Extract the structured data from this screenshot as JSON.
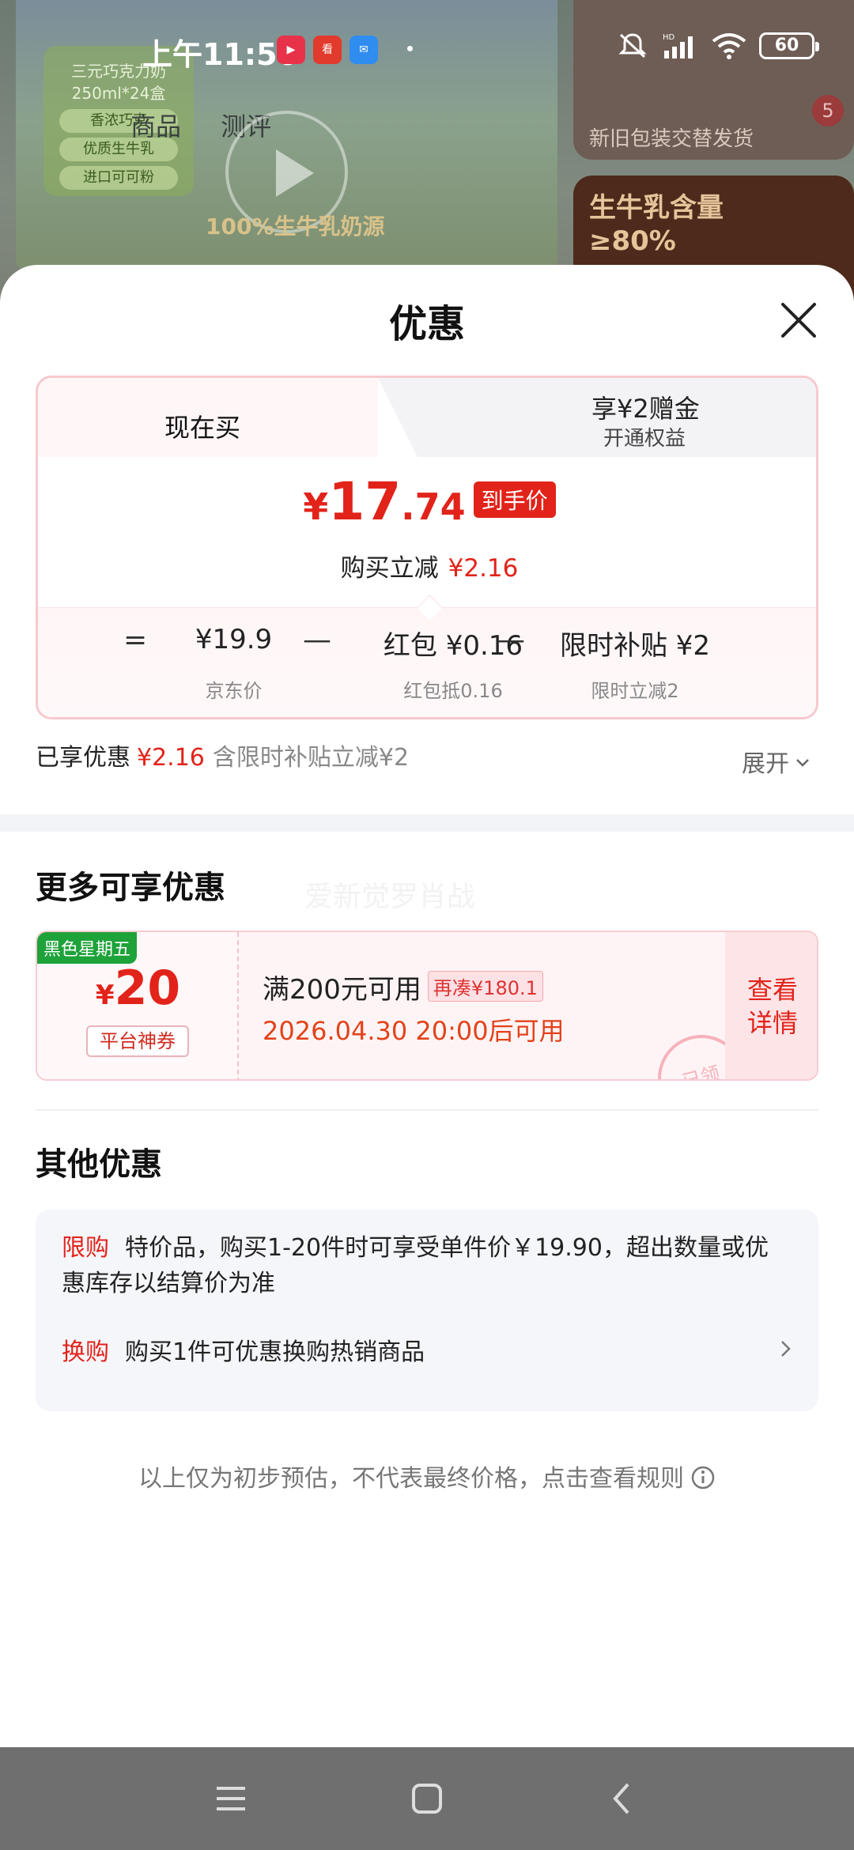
{
  "status_bar": {
    "time": "上午11:50",
    "battery": "60",
    "network_label": "HD",
    "app_icons": [
      "video-app-icon",
      "news-app-icon",
      "chat-app-icon"
    ]
  },
  "background": {
    "tabs": [
      "商品",
      "测评"
    ],
    "green_box_lines": [
      "三元巧克力奶",
      "250ml*24盒"
    ],
    "green_box_tags": [
      "香浓巧克",
      "优质生牛乳",
      "进口可可粉"
    ],
    "slogan": "100%生牛乳奶源",
    "card1_caption": "新旧包装交替发货",
    "card2_caption": "生牛乳含量\n≥80%",
    "badge": "5"
  },
  "sheet": {
    "title": "优惠",
    "tabs": {
      "now": "现在买",
      "other_title": "享¥2赠金",
      "other_sub": "开通权益"
    },
    "price": {
      "yen": "¥",
      "integer": "17",
      "decimal": ".74",
      "tag": "到手价",
      "reduce_label": "购买立减",
      "reduce_amount": "¥2.16"
    },
    "breakdown": {
      "eq": "=",
      "items": [
        {
          "value": "¥19.9",
          "sub": "京东价"
        },
        {
          "value": "红包 ¥0.16",
          "sub": "红包抵0.16"
        },
        {
          "value": "限时补贴 ¥2",
          "sub": "限时立减2"
        }
      ],
      "op": "—"
    },
    "enjoyed": {
      "label": "已享优惠",
      "amount": "¥2.16",
      "note": "含限时补贴立减¥2",
      "expand": "展开"
    },
    "more": {
      "title": "更多可享优惠",
      "watermark": "爱新觉罗肖战",
      "coupon": {
        "tag": "黑色星期五",
        "yen": "¥",
        "amount": "20",
        "type": "平台神券",
        "condition": "满200元可用",
        "need": "再凑¥180.1",
        "date": "2026.04.30 20:00后可用",
        "detail": "查看\n详情",
        "stamp": "已领"
      }
    },
    "other": {
      "title": "其他优惠",
      "rows": [
        {
          "key": "限购",
          "text": "特价品，购买1-20件时可享受单件价￥19.90，超出数量或优惠库存以结算价为准"
        },
        {
          "key": "换购",
          "text": "购买1件可优惠换购热销商品"
        }
      ]
    },
    "footnote": "以上仅为初步预估，不代表最终价格，点击查看规则"
  },
  "colors": {
    "accent_red": "#e2231a",
    "coupon_green": "#1ea23a",
    "border_pink": "#f7c9cf"
  }
}
